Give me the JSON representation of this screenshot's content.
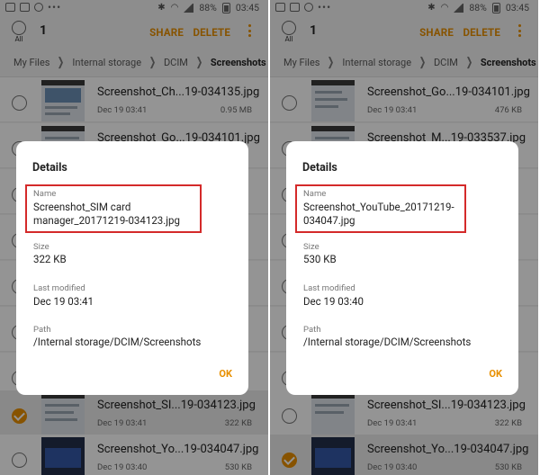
{
  "status_bar": {
    "battery": "88%",
    "time": "03:45"
  },
  "left": {
    "appbar": {
      "all_label": "All",
      "count": "1",
      "share": "SHARE",
      "delete": "DELETE"
    },
    "breadcrumb": [
      "My Files",
      "Internal storage",
      "DCIM",
      "Screenshots"
    ],
    "files": [
      {
        "name": "Screenshot_Ch...19-034135.jpg",
        "date": "Dec 19 03:41",
        "size": "0.95 MB",
        "selected": false
      },
      {
        "name": "Screenshot_Go...19-034101.jpg",
        "date": "",
        "size": "",
        "selected": false
      },
      {
        "name": "",
        "date": "",
        "size": "",
        "selected": false
      },
      {
        "name": "",
        "date": "",
        "size": "",
        "selected": false
      },
      {
        "name": "",
        "date": "",
        "size": "",
        "selected": false
      },
      {
        "name": "",
        "date": "",
        "size": "",
        "selected": false
      },
      {
        "name": "",
        "date": "",
        "size": "",
        "selected": false
      },
      {
        "name": "Screenshot_SI...19-034123.jpg",
        "date": "Dec 19 03:41",
        "size": "322 KB",
        "selected": true
      },
      {
        "name": "Screenshot_Yo...19-034047.jpg",
        "date": "Dec 19 03:40",
        "size": "530 KB",
        "selected": false
      }
    ],
    "dialog": {
      "title": "Details",
      "name_label": "Name",
      "name_value": "Screenshot_SIM card manager_20171219-034123.jpg",
      "size_label": "Size",
      "size_value": "322 KB",
      "modified_label": "Last modified",
      "modified_value": "Dec 19 03:41",
      "path_label": "Path",
      "path_value": "/Internal storage/DCIM/Screenshots",
      "ok": "OK"
    }
  },
  "right": {
    "appbar": {
      "all_label": "All",
      "count": "1",
      "share": "SHARE",
      "delete": "DELETE"
    },
    "breadcrumb": [
      "My Files",
      "Internal storage",
      "DCIM",
      "Screenshots"
    ],
    "files": [
      {
        "name": "Screenshot_Go...19-034101.jpg",
        "date": "Dec 19 03:41",
        "size": "476 KB",
        "selected": false
      },
      {
        "name": "Screenshot_M...19-033537.jpg",
        "date": "",
        "size": "",
        "selected": false
      },
      {
        "name": "",
        "date": "",
        "size": "",
        "selected": false
      },
      {
        "name": "",
        "date": "",
        "size": "",
        "selected": false
      },
      {
        "name": "",
        "date": "",
        "size": "",
        "selected": false
      },
      {
        "name": "",
        "date": "",
        "size": "",
        "selected": false
      },
      {
        "name": "",
        "date": "",
        "size": "",
        "selected": false
      },
      {
        "name": "Screenshot_SI...19-034123.jpg",
        "date": "Dec 19 03:41",
        "size": "322 KB",
        "selected": false
      },
      {
        "name": "Screenshot_Yo...19-034047.jpg",
        "date": "Dec 19 03:40",
        "size": "530 KB",
        "selected": true
      }
    ],
    "dialog": {
      "title": "Details",
      "name_label": "Name",
      "name_value": "Screenshot_YouTube_20171219-034047.jpg",
      "size_label": "Size",
      "size_value": "530 KB",
      "modified_label": "Last modified",
      "modified_value": "Dec 19 03:40",
      "path_label": "Path",
      "path_value": "/Internal storage/DCIM/Screenshots",
      "ok": "OK"
    }
  },
  "colors": {
    "accent": "#e89000",
    "highlight_box": "#d42a2a"
  }
}
